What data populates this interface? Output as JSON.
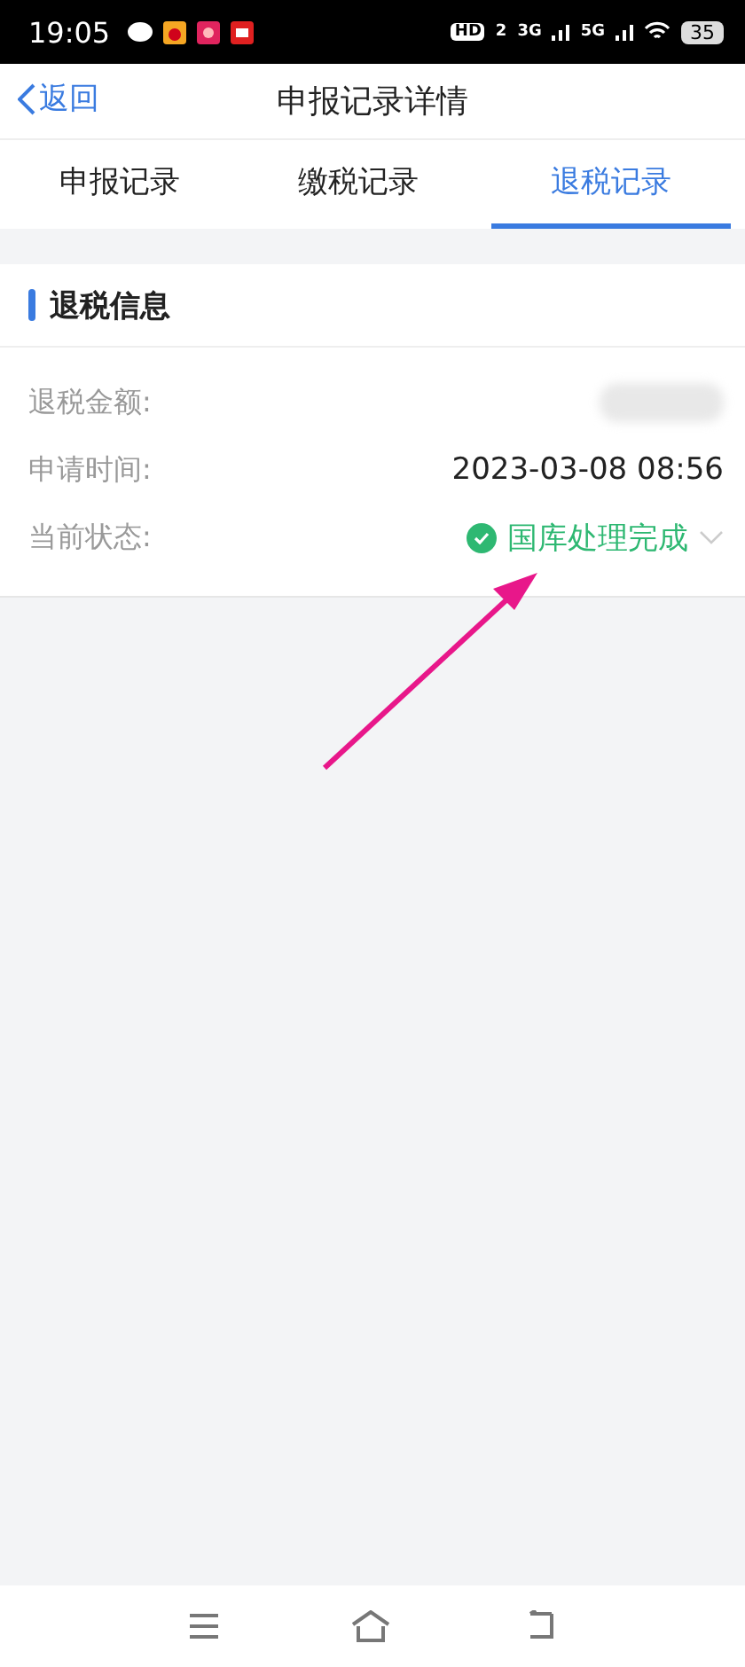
{
  "status_bar": {
    "time": "19:05",
    "hd": "HD",
    "hd_sub": "2",
    "net1": "3G",
    "net2": "5G",
    "battery": "35"
  },
  "header": {
    "back": "返回",
    "title": "申报记录详情"
  },
  "tabs": [
    {
      "label": "申报记录",
      "selected": false
    },
    {
      "label": "缴税记录",
      "selected": false
    },
    {
      "label": "退税记录",
      "selected": true
    }
  ],
  "section": {
    "title": "退税信息",
    "rows": [
      {
        "label": "退税金额:",
        "kind": "hidden"
      },
      {
        "label": "申请时间:",
        "kind": "text",
        "value": "2023-03-08 08:56"
      },
      {
        "label": "当前状态:",
        "kind": "status",
        "value": "国库处理完成",
        "color": "#2eb872"
      }
    ]
  }
}
